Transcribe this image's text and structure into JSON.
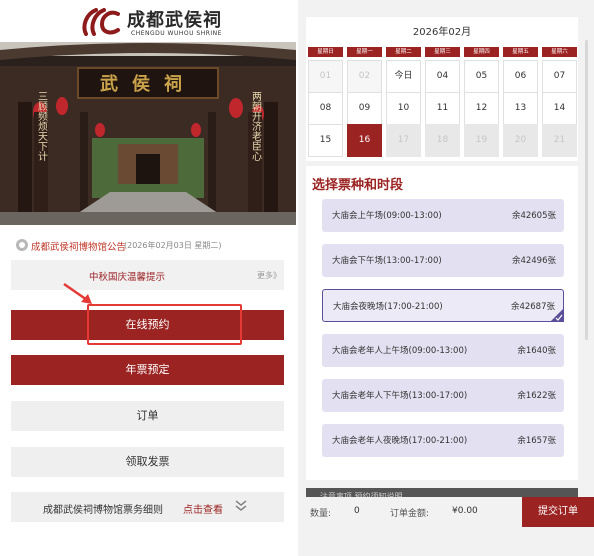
{
  "logo": {
    "cn": "成都武侯祠",
    "en": "CHENGDU WUHOU SHRINE"
  },
  "hero": {
    "plaque": "武侯祠",
    "couplet_left": "三顾频烦天下计",
    "couplet_right": "两朝开济老臣心"
  },
  "notice": {
    "title": "成都武侯祠博物馆公告",
    "date": "(2026年02月03日 星期二)",
    "banner": "中秋国庆温馨提示",
    "more": "更多》"
  },
  "buttons": {
    "online": "在线预约",
    "annual": "年票预定",
    "order": "订单",
    "invoice": "领取发票"
  },
  "rules": {
    "text": "成都武侯祠博物馆票务细则",
    "link": "点击查看"
  },
  "calendar": {
    "title": "2026年02月",
    "weekdays": [
      "星期日",
      "星期一",
      "星期二",
      "星期三",
      "星期四",
      "星期五",
      "星期六"
    ],
    "row1": [
      "01",
      "02",
      "今日",
      "04",
      "05",
      "06",
      "07"
    ],
    "row2": [
      "08",
      "09",
      "10",
      "11",
      "12",
      "13",
      "14"
    ],
    "row3": [
      "15",
      "16",
      "17",
      "18",
      "19",
      "20",
      "21"
    ]
  },
  "tickets": {
    "title": "选择票种和时段",
    "items": [
      {
        "name": "大庙会上午场(09:00-13:00)",
        "stock": "余42605张"
      },
      {
        "name": "大庙会下午场(13:00-17:00)",
        "stock": "余42496张"
      },
      {
        "name": "大庙会夜晚场(17:00-21:00)",
        "stock": "余42687张"
      },
      {
        "name": "大庙会老年人上午场(09:00-13:00)",
        "stock": "余1640张"
      },
      {
        "name": "大庙会老年人下午场(13:00-17:00)",
        "stock": "余1622张"
      },
      {
        "name": "大庙会老年人夜晚场(17:00-21:00)",
        "stock": "余1657张"
      }
    ]
  },
  "under_text": "注意事项  预约须知说明",
  "bottom": {
    "qty_label": "数量:",
    "qty": "0",
    "amount_label": "订单金额:",
    "amount": "¥0.00",
    "submit": "提交订单"
  }
}
